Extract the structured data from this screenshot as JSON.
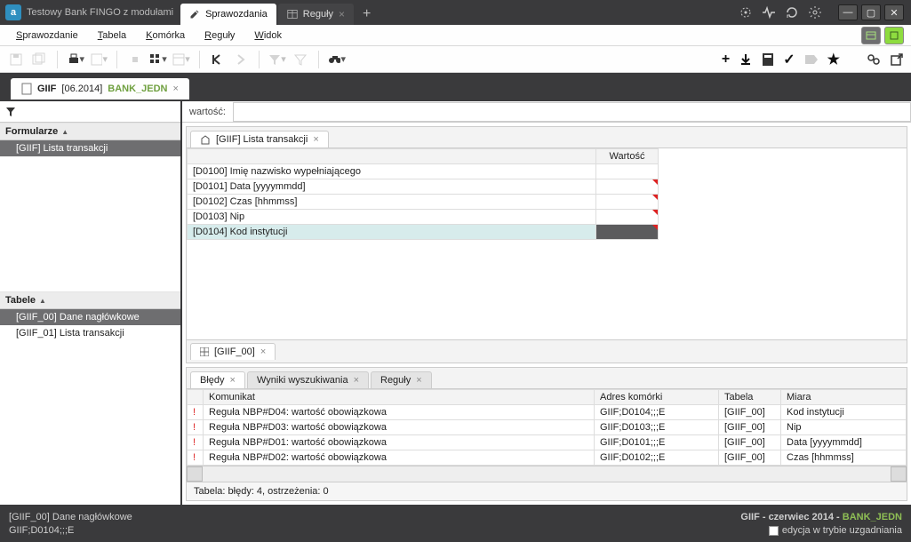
{
  "app": {
    "title": "Testowy Bank FINGO z modułami"
  },
  "topTabs": [
    {
      "label": "Sprawozdania",
      "active": true
    },
    {
      "label": "Reguły",
      "active": false
    }
  ],
  "menu": {
    "items": [
      "Sprawozdanie",
      "Tabela",
      "Komórka",
      "Reguły",
      "Widok"
    ]
  },
  "reportTab": {
    "code": "GIIF",
    "period": "[06.2014]",
    "bank": "BANK_JEDN"
  },
  "valueBar": {
    "label": "wartość:"
  },
  "leftPanels": {
    "forms": {
      "header": "Formularze",
      "items": [
        "[GIIF] Lista transakcji"
      ],
      "selected": 0
    },
    "tables": {
      "header": "Tabele",
      "items": [
        "[GIIF_00] Dane nagłówkowe",
        "[GIIF_01] Lista transakcji"
      ],
      "selected": 0
    }
  },
  "innerTab": {
    "label": "[GIIF] Lista transakcji"
  },
  "grid": {
    "headers": [
      "",
      "Wartość"
    ],
    "rows": [
      {
        "label": "[D0100] Imię nazwisko wypełniającego",
        "value": "",
        "err": false,
        "sel": false
      },
      {
        "label": "[D0101] Data [yyyymmdd]",
        "value": "",
        "err": true,
        "sel": false
      },
      {
        "label": "[D0102] Czas [hhmmss]",
        "value": "",
        "err": true,
        "sel": false
      },
      {
        "label": "[D0103] Nip",
        "value": "",
        "err": true,
        "sel": false
      },
      {
        "label": "[D0104] Kod instytucji",
        "value": "",
        "err": true,
        "sel": true
      }
    ]
  },
  "sheetTab": {
    "label": "[GIIF_00]"
  },
  "bottomTabs": {
    "items": [
      "Błędy",
      "Wyniki wyszukiwania",
      "Reguły"
    ],
    "active": 0
  },
  "errors": {
    "headers": [
      "",
      "Komunikat",
      "Adres komórki",
      "Tabela",
      "Miara"
    ],
    "rows": [
      {
        "msg": "Reguła NBP#D04: wartość obowiązkowa",
        "addr": "GIIF;D0104;;;E",
        "table": "[GIIF_00]",
        "measure": "Kod instytucji"
      },
      {
        "msg": "Reguła NBP#D03: wartość obowiązkowa",
        "addr": "GIIF;D0103;;;E",
        "table": "[GIIF_00]",
        "measure": "Nip"
      },
      {
        "msg": "Reguła NBP#D01: wartość obowiązkowa",
        "addr": "GIIF;D0101;;;E",
        "table": "[GIIF_00]",
        "measure": "Data [yyyymmdd]"
      },
      {
        "msg": "Reguła NBP#D02: wartość obowiązkowa",
        "addr": "GIIF;D0102;;;E",
        "table": "[GIIF_00]",
        "measure": "Czas [hhmmss]"
      }
    ],
    "summary": "Tabela: błędy: 4, ostrzeżenia: 0"
  },
  "status": {
    "left1": "[GIIF_00] Dane nagłówkowe",
    "left2": "GIIF;D0104;;;E",
    "right1_prefix": "GIIF - czerwiec 2014 - ",
    "right1_bank": "BANK_JEDN",
    "right2": "edycja w trybie uzgadniania"
  }
}
